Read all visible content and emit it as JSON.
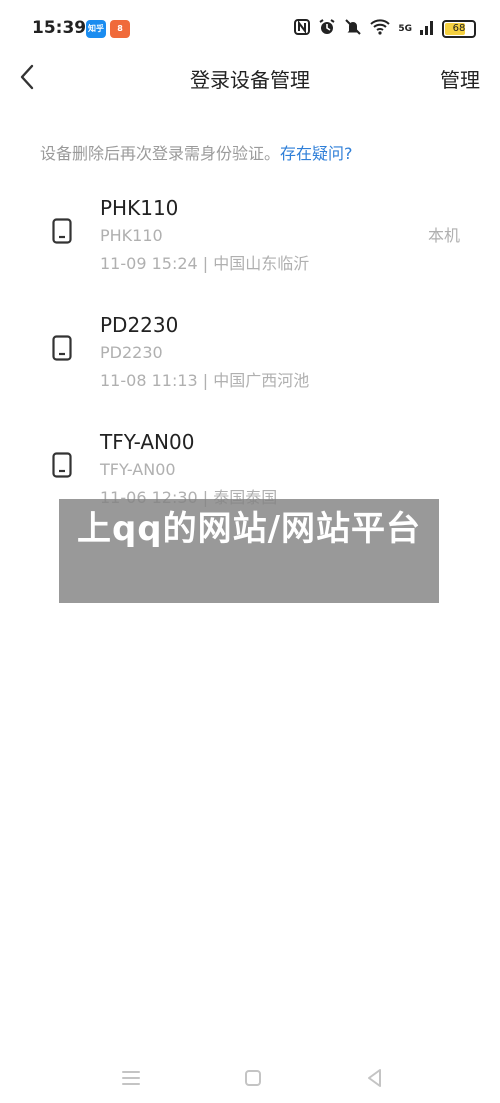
{
  "status_bar": {
    "time": "15:39",
    "app_badges": [
      {
        "label": "知乎",
        "color": "#1a8cf0"
      },
      {
        "label": "8",
        "color": "#f06a3a"
      }
    ],
    "network": "5G",
    "battery": "68"
  },
  "header": {
    "title": "登录设备管理",
    "manage_label": "管理"
  },
  "notice": {
    "text": "设备删除后再次登录需身份验证。",
    "link": "存在疑问?"
  },
  "devices": [
    {
      "name": "PHK110",
      "model": "PHK110",
      "meta": "11-09 15:24 | 中国山东临沂",
      "tag": "本机"
    },
    {
      "name": "PD2230",
      "model": "PD2230",
      "meta": "11-08 11:13 | 中国广西河池",
      "tag": ""
    },
    {
      "name": "TFY-AN00",
      "model": "TFY-AN00",
      "meta": "11-06 12:30 | 泰国泰国",
      "tag": ""
    }
  ],
  "overlay": {
    "text": "上qq的网站/网站平台"
  },
  "colors": {
    "link": "#2f7fd8",
    "muted": "#b0b0b0",
    "overlay": "#828282"
  }
}
